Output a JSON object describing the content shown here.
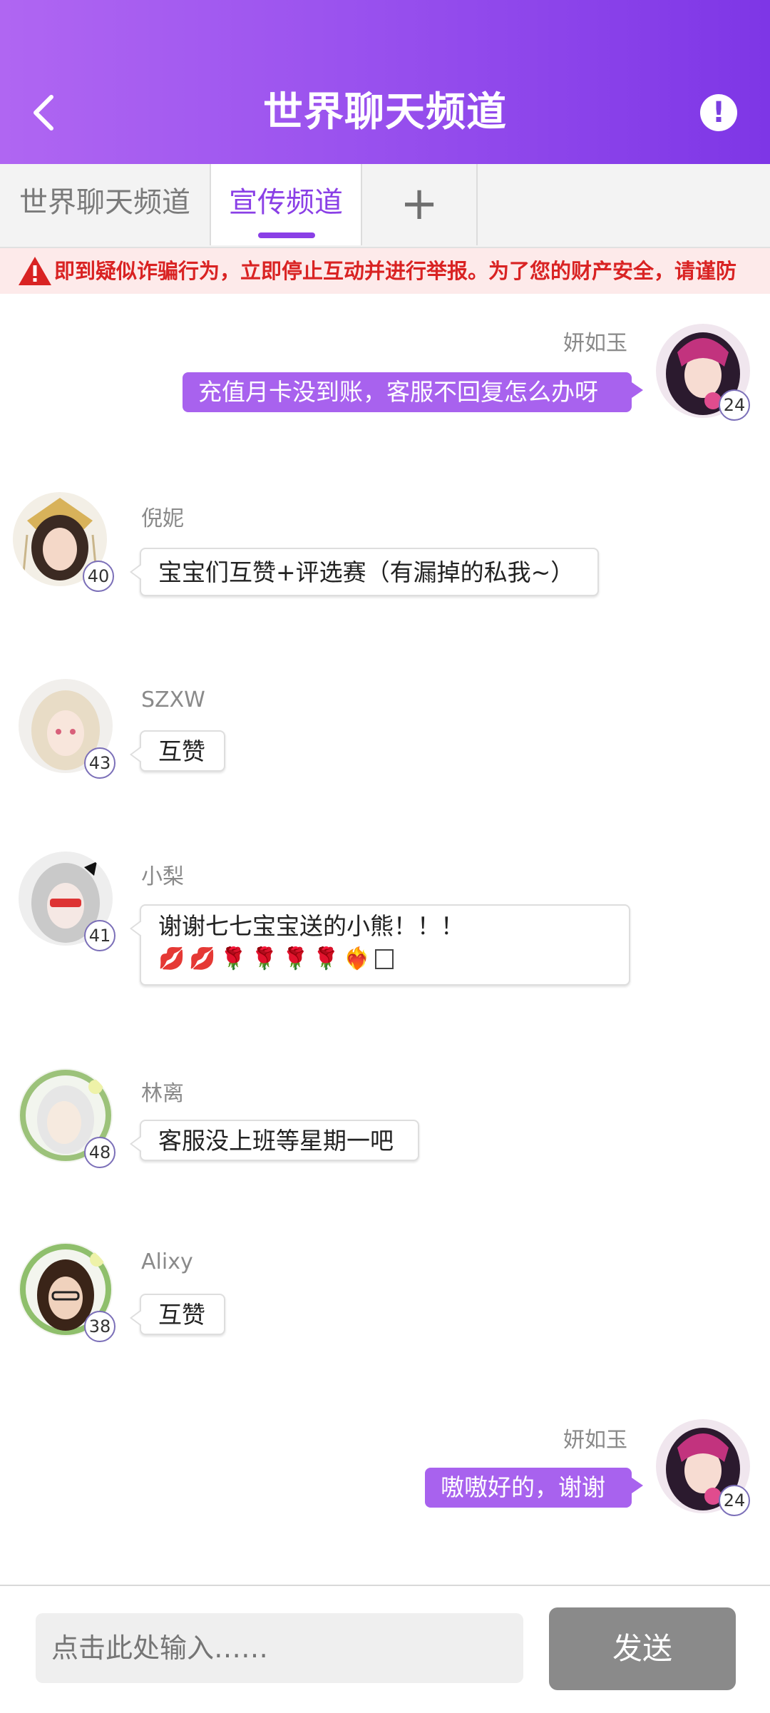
{
  "header": {
    "title": "世界聊天频道",
    "back_icon": "chevron-left-icon",
    "info_icon": "exclamation-circle-icon"
  },
  "tabs": [
    {
      "label": "世界聊天频道",
      "active": false
    },
    {
      "label": "宣传频道",
      "active": true
    },
    {
      "label": "+",
      "active": false
    }
  ],
  "warning": {
    "icon": "warning-triangle-icon",
    "text": "即到疑似诈骗行为，立即停止互动并进行举报。为了您的财产安全，请谨防"
  },
  "messages": [
    {
      "side": "right",
      "username": "妍如玉",
      "level": "24",
      "text": "充值月卡没到账，客服不回复怎么办呀"
    },
    {
      "side": "left",
      "username": "倪妮",
      "level": "40",
      "text": "宝宝们互赞+评选赛（有漏掉的私我~）"
    },
    {
      "side": "left",
      "username": "SZXW",
      "level": "43",
      "text": "互赞"
    },
    {
      "side": "left",
      "username": "小梨",
      "level": "41",
      "text": "谢谢七七宝宝送的小熊！！！",
      "emojis": [
        "💋",
        "💋",
        "🌹",
        "🌹",
        "🌹",
        "🌹",
        "❤️‍🔥"
      ]
    },
    {
      "side": "left",
      "username": "林离",
      "level": "48",
      "text": "客服没上班等星期一吧"
    },
    {
      "side": "left",
      "username": "Alixy",
      "level": "38",
      "text": "互赞"
    },
    {
      "side": "right",
      "username": "妍如玉",
      "level": "24",
      "text": "嗷嗷好的，谢谢"
    }
  ],
  "composer": {
    "placeholder": "点击此处输入……",
    "send_label": "发送"
  },
  "colors": {
    "header_start": "#b066f2",
    "header_end": "#7e36e6",
    "accent": "#8a3fe6",
    "own_bubble": "#a862ee",
    "warning_text": "#d92323",
    "send_button": "#8a8a8a"
  }
}
